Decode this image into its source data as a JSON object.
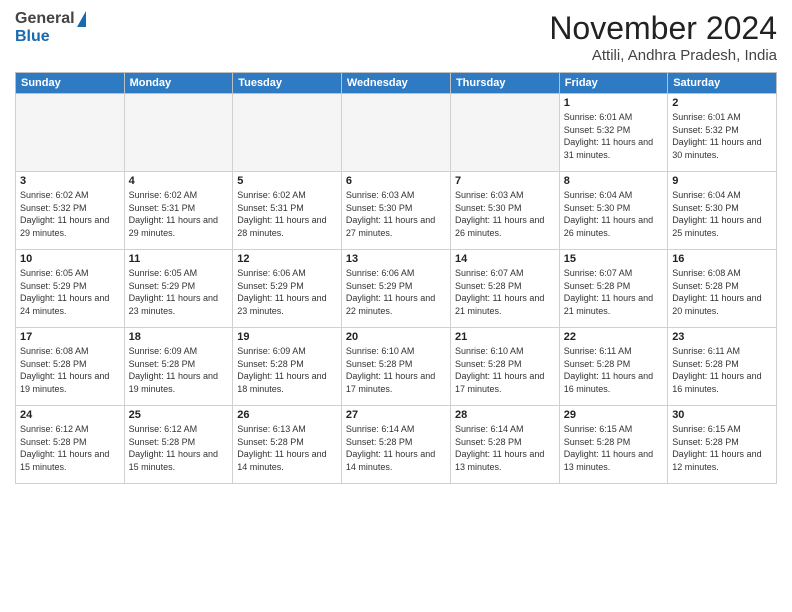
{
  "logo": {
    "general": "General",
    "blue": "Blue"
  },
  "header": {
    "month": "November 2024",
    "location": "Attili, Andhra Pradesh, India"
  },
  "weekdays": [
    "Sunday",
    "Monday",
    "Tuesday",
    "Wednesday",
    "Thursday",
    "Friday",
    "Saturday"
  ],
  "weeks": [
    [
      {
        "day": "",
        "info": ""
      },
      {
        "day": "",
        "info": ""
      },
      {
        "day": "",
        "info": ""
      },
      {
        "day": "",
        "info": ""
      },
      {
        "day": "",
        "info": ""
      },
      {
        "day": "1",
        "info": "Sunrise: 6:01 AM\nSunset: 5:32 PM\nDaylight: 11 hours\nand 31 minutes."
      },
      {
        "day": "2",
        "info": "Sunrise: 6:01 AM\nSunset: 5:32 PM\nDaylight: 11 hours\nand 30 minutes."
      }
    ],
    [
      {
        "day": "3",
        "info": "Sunrise: 6:02 AM\nSunset: 5:32 PM\nDaylight: 11 hours\nand 29 minutes."
      },
      {
        "day": "4",
        "info": "Sunrise: 6:02 AM\nSunset: 5:31 PM\nDaylight: 11 hours\nand 29 minutes."
      },
      {
        "day": "5",
        "info": "Sunrise: 6:02 AM\nSunset: 5:31 PM\nDaylight: 11 hours\nand 28 minutes."
      },
      {
        "day": "6",
        "info": "Sunrise: 6:03 AM\nSunset: 5:30 PM\nDaylight: 11 hours\nand 27 minutes."
      },
      {
        "day": "7",
        "info": "Sunrise: 6:03 AM\nSunset: 5:30 PM\nDaylight: 11 hours\nand 26 minutes."
      },
      {
        "day": "8",
        "info": "Sunrise: 6:04 AM\nSunset: 5:30 PM\nDaylight: 11 hours\nand 26 minutes."
      },
      {
        "day": "9",
        "info": "Sunrise: 6:04 AM\nSunset: 5:30 PM\nDaylight: 11 hours\nand 25 minutes."
      }
    ],
    [
      {
        "day": "10",
        "info": "Sunrise: 6:05 AM\nSunset: 5:29 PM\nDaylight: 11 hours\nand 24 minutes."
      },
      {
        "day": "11",
        "info": "Sunrise: 6:05 AM\nSunset: 5:29 PM\nDaylight: 11 hours\nand 23 minutes."
      },
      {
        "day": "12",
        "info": "Sunrise: 6:06 AM\nSunset: 5:29 PM\nDaylight: 11 hours\nand 23 minutes."
      },
      {
        "day": "13",
        "info": "Sunrise: 6:06 AM\nSunset: 5:29 PM\nDaylight: 11 hours\nand 22 minutes."
      },
      {
        "day": "14",
        "info": "Sunrise: 6:07 AM\nSunset: 5:28 PM\nDaylight: 11 hours\nand 21 minutes."
      },
      {
        "day": "15",
        "info": "Sunrise: 6:07 AM\nSunset: 5:28 PM\nDaylight: 11 hours\nand 21 minutes."
      },
      {
        "day": "16",
        "info": "Sunrise: 6:08 AM\nSunset: 5:28 PM\nDaylight: 11 hours\nand 20 minutes."
      }
    ],
    [
      {
        "day": "17",
        "info": "Sunrise: 6:08 AM\nSunset: 5:28 PM\nDaylight: 11 hours\nand 19 minutes."
      },
      {
        "day": "18",
        "info": "Sunrise: 6:09 AM\nSunset: 5:28 PM\nDaylight: 11 hours\nand 19 minutes."
      },
      {
        "day": "19",
        "info": "Sunrise: 6:09 AM\nSunset: 5:28 PM\nDaylight: 11 hours\nand 18 minutes."
      },
      {
        "day": "20",
        "info": "Sunrise: 6:10 AM\nSunset: 5:28 PM\nDaylight: 11 hours\nand 17 minutes."
      },
      {
        "day": "21",
        "info": "Sunrise: 6:10 AM\nSunset: 5:28 PM\nDaylight: 11 hours\nand 17 minutes."
      },
      {
        "day": "22",
        "info": "Sunrise: 6:11 AM\nSunset: 5:28 PM\nDaylight: 11 hours\nand 16 minutes."
      },
      {
        "day": "23",
        "info": "Sunrise: 6:11 AM\nSunset: 5:28 PM\nDaylight: 11 hours\nand 16 minutes."
      }
    ],
    [
      {
        "day": "24",
        "info": "Sunrise: 6:12 AM\nSunset: 5:28 PM\nDaylight: 11 hours\nand 15 minutes."
      },
      {
        "day": "25",
        "info": "Sunrise: 6:12 AM\nSunset: 5:28 PM\nDaylight: 11 hours\nand 15 minutes."
      },
      {
        "day": "26",
        "info": "Sunrise: 6:13 AM\nSunset: 5:28 PM\nDaylight: 11 hours\nand 14 minutes."
      },
      {
        "day": "27",
        "info": "Sunrise: 6:14 AM\nSunset: 5:28 PM\nDaylight: 11 hours\nand 14 minutes."
      },
      {
        "day": "28",
        "info": "Sunrise: 6:14 AM\nSunset: 5:28 PM\nDaylight: 11 hours\nand 13 minutes."
      },
      {
        "day": "29",
        "info": "Sunrise: 6:15 AM\nSunset: 5:28 PM\nDaylight: 11 hours\nand 13 minutes."
      },
      {
        "day": "30",
        "info": "Sunrise: 6:15 AM\nSunset: 5:28 PM\nDaylight: 11 hours\nand 12 minutes."
      }
    ]
  ]
}
